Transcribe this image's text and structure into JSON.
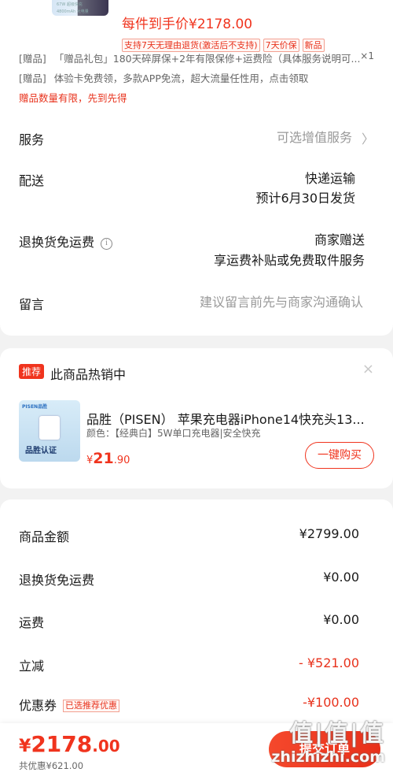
{
  "header": {
    "thumb_lines": [
      "67W 超级快充",
      "4800mAh 大电量"
    ],
    "price_line": "每件到手价¥2178.00",
    "tags": [
      "支持7天无理由退货(激活后不支持)",
      "7天价保",
      "新品"
    ]
  },
  "gifts": {
    "items": [
      {
        "tag": "[赠品]",
        "text": "「赠品礼包」180天碎屏保+2年有限保修+运费险（具体服务说明可...",
        "qty": "×1"
      },
      {
        "tag": "[赠品]",
        "text": "体验卡免费领，多款APP免流，超大流量任性用，点击领取"
      }
    ],
    "warning": "赠品数量有限，先到先得"
  },
  "rows": {
    "service": {
      "label": "服务",
      "value": "可选增值服务"
    },
    "delivery": {
      "label": "配送",
      "value1": "快递运输",
      "value2": "预计6月30日发货"
    },
    "return_fee": {
      "label": "退换货免运费",
      "value1": "商家赠送",
      "value2": "享运费补贴或免费取件服务"
    },
    "message": {
      "label": "留言",
      "placeholder": "建议留言前先与商家沟通确认"
    }
  },
  "recommend": {
    "badge": "推荐",
    "title": "此商品热销中",
    "image_brand": "PISEN品胜",
    "image_cert": "品胜认证",
    "name": "品胜（PISEN） 苹果充电器iPhone14快充头13...",
    "spec": "颜色：【经典白】5W单口充电器|安全快充",
    "price_symbol": "¥",
    "price_int": "21",
    "price_dec": ".90",
    "button": "一键购买"
  },
  "summary": {
    "items": [
      {
        "label": "商品金额",
        "value": "¥2799.00"
      },
      {
        "label": "退换货免运费",
        "value": "¥0.00"
      },
      {
        "label": "运费",
        "value": "¥0.00"
      },
      {
        "label": "立减",
        "value": "- ¥521.00"
      },
      {
        "label": "优惠券",
        "tag": "已选推荐优惠",
        "value": "-¥100.00"
      }
    ]
  },
  "footer": {
    "total_symbol": "¥",
    "total_int": "2178",
    "total_dec": ".00",
    "saved": "共优惠¥621.00",
    "pay_button": "提交订单",
    "watermark_logo": "值|值|值",
    "watermark_site": "zhizhizhi.com"
  },
  "colors": {
    "accent": "#f0341e",
    "background": "#f2f2f2"
  }
}
